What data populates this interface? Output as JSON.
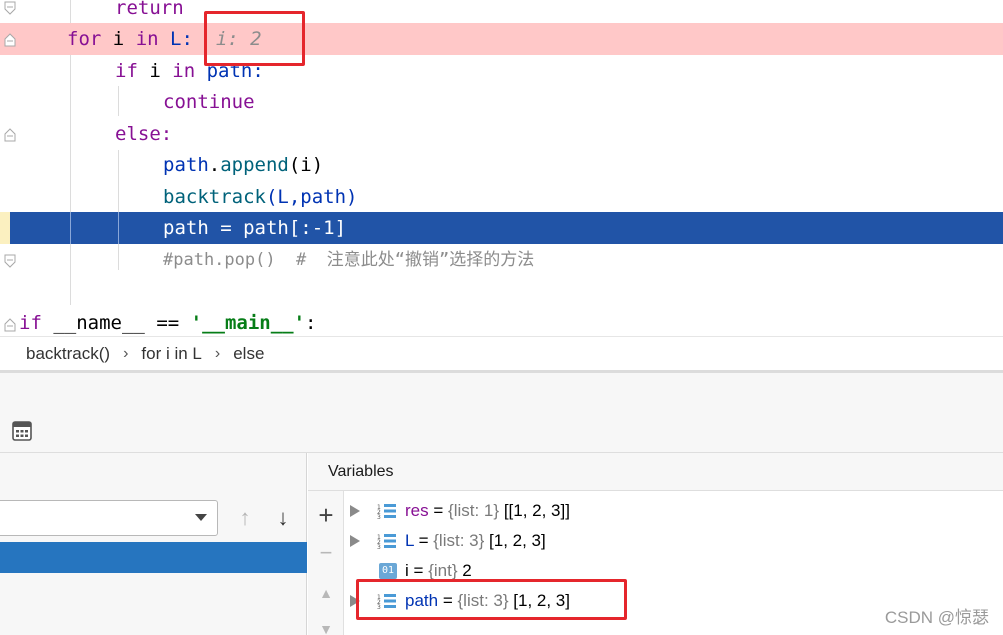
{
  "editor": {
    "lines": {
      "l1": {
        "kw": "return"
      },
      "l2": {
        "for": "for",
        "var": "i",
        "in": "in",
        "target": "L:",
        "hint": "i: 2"
      },
      "l3": {
        "if": "if",
        "var": "i",
        "in": "in",
        "target": "path:"
      },
      "l4": {
        "kw": "continue"
      },
      "l5": {
        "kw": "else:"
      },
      "l6": {
        "obj": "path",
        "dot": ".",
        "fn": "append",
        "args": "(i)"
      },
      "l7": {
        "fn": "backtrack",
        "args": "(L,path)"
      },
      "l8": {
        "code": "path = path[:-1]"
      },
      "l9": {
        "comment": "#path.pop()  #  注意此处“撤销”选择的方法"
      },
      "l10": {
        "if": "if",
        "name": "__name__",
        "op": "==",
        "str": "'__main__'",
        "colon": ":"
      }
    }
  },
  "breadcrumb": {
    "items": [
      "backtrack()",
      "for i in L",
      "else"
    ],
    "separator": "›"
  },
  "frames": {
    "up_arrow": "↑",
    "down_arrow": "↓"
  },
  "variables": {
    "title": "Variables",
    "add_label": "+",
    "remove_label": "−",
    "up_label": "▲",
    "down_label": "▼",
    "items": [
      {
        "name": "res",
        "eq": "=",
        "type": "{list: 1}",
        "value": "[[1, 2, 3]]"
      },
      {
        "name": "L",
        "eq": "=",
        "type": "{list: 3}",
        "value": "[1, 2, 3]"
      },
      {
        "name": "i",
        "eq": "=",
        "type": "{int}",
        "value": "2",
        "badge": "01"
      },
      {
        "name": "path",
        "eq": "=",
        "type": "{list: 3}",
        "value": "[1, 2, 3]"
      }
    ]
  },
  "watermark": "CSDN @惊瑟",
  "colors": {
    "highlight_line": "#ffc8c8",
    "selection_line": "#2154a7",
    "annotation_box": "#e5262c",
    "selected_frame": "#2675bf"
  }
}
